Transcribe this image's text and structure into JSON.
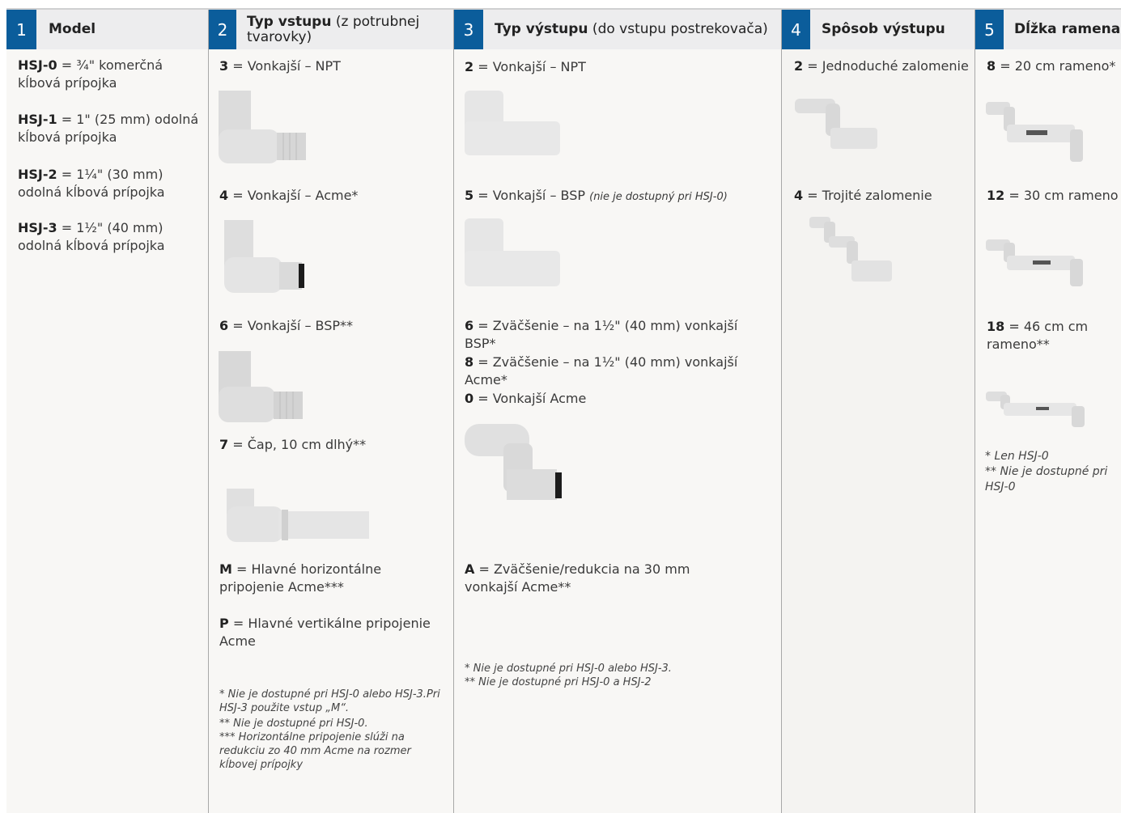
{
  "columns": [
    {
      "num": "1",
      "title": "Model",
      "title_rest": ""
    },
    {
      "num": "2",
      "title": "Typ vstupu",
      "title_rest": " (z potrubnej tvarovky)"
    },
    {
      "num": "3",
      "title": "Typ výstupu",
      "title_rest": " (do vstupu postrekovača)"
    },
    {
      "num": "4",
      "title": "Spôsob výstupu",
      "title_rest": ""
    },
    {
      "num": "5",
      "title": "Dĺžka ramena",
      "title_rest": ""
    }
  ],
  "col1": {
    "items": [
      {
        "code": "HSJ-0",
        "text": " = ¾\" komerčná kĺbová prípojka"
      },
      {
        "code": "HSJ-1",
        "text": " = 1\" (25 mm) odolná kĺbová prípojka"
      },
      {
        "code": "HSJ-2",
        "text": " = 1¼\" (30 mm) odolná kĺbová prípojka"
      },
      {
        "code": "HSJ-3",
        "text": " = 1½\" (40 mm) odolná kĺbová prípojka"
      }
    ]
  },
  "col2": {
    "items": [
      {
        "code": "3",
        "text": " = Vonkajší – NPT"
      },
      {
        "code": "4",
        "text": " = Vonkajší – Acme*"
      },
      {
        "code": "6",
        "text": " = Vonkajší – BSP**"
      },
      {
        "code": "7",
        "text": " = Čap, 10 cm dlhý**"
      },
      {
        "code": "M",
        "text": " = Hlavné horizontálne pripojenie Acme***"
      },
      {
        "code": "P",
        "text": " = Hlavné vertikálne pripojenie Acme"
      }
    ],
    "notes": [
      "* Nie je dostupné pri HSJ-0 alebo HSJ-3.Pri HSJ-3 použite vstup „M“.",
      "** Nie je dostupné pri HSJ-0.",
      "*** Horizontálne pripojenie slúži na redukciu zo 40 mm Acme na rozmer kĺbovej prípojky"
    ]
  },
  "col3": {
    "items": [
      {
        "code": "2",
        "text": " = Vonkajší – NPT"
      },
      {
        "code": "5",
        "text": " = Vonkajší – BSP ",
        "italic": "(nie je dostupný pri HSJ-0)"
      },
      {
        "code": "6",
        "text": " = Zväčšenie – na 1½\" (40 mm) vonkajší BSP*"
      },
      {
        "code": "8",
        "text": " = Zväčšenie – na 1½\" (40 mm) vonkajší Acme*"
      },
      {
        "code": "0",
        "text": " = Vonkajší Acme"
      },
      {
        "code": "A",
        "text": " = Zväčšenie/redukcia na 30 mm vonkajší Acme**"
      }
    ],
    "notes": [
      "* Nie je dostupné pri HSJ-0 alebo HSJ-3.",
      "** Nie je dostupné pri HSJ-0 a HSJ-2"
    ]
  },
  "col4": {
    "items": [
      {
        "code": "2",
        "text": " = Jednoduché zalomenie"
      },
      {
        "code": "4",
        "text": " = Trojité zalomenie"
      }
    ]
  },
  "col5": {
    "items": [
      {
        "code": "8",
        "text": " = 20 cm rameno*"
      },
      {
        "code": "12",
        "text": " = 30 cm rameno"
      },
      {
        "code": "18",
        "text": " = 46 cm cm rameno**"
      }
    ],
    "notes": [
      "* Len HSJ-0",
      "** Nie je dostupné pri HSJ-0"
    ]
  }
}
